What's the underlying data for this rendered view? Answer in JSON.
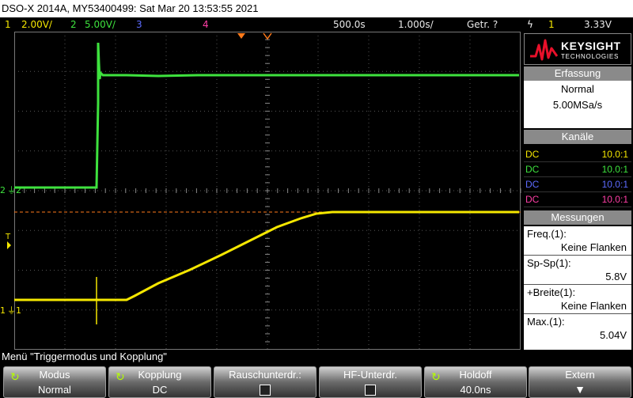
{
  "title_bar": "DSO-X 2014A, MY53400499: Sat Mar 20 13:53:55 2021",
  "status": {
    "ch1_num": "1",
    "ch1_scale": "2.00V/",
    "ch2_num": "2",
    "ch2_scale": "5.00V/",
    "ch3_num": "3",
    "ch4_num": "4",
    "timebase": "500.0s",
    "delay": "1.000s/",
    "mode": "Getr. ?",
    "trig_icon": "ϟ",
    "trig_source": "1",
    "trig_level": "3.33V"
  },
  "markers": {
    "ch2": "2",
    "ch1": "1",
    "trig": "T"
  },
  "logo": {
    "brand": "KEYSIGHT",
    "sub": "TECHNOLOGIES"
  },
  "acquisition": {
    "header": "Erfassung",
    "mode": "Normal",
    "rate": "5.00MSa/s"
  },
  "channels": {
    "header": "Kanäle",
    "rows": [
      {
        "coupling": "DC",
        "probe": "10.0:1",
        "color": "#f5e700"
      },
      {
        "coupling": "DC",
        "probe": "10.0:1",
        "color": "#3ee23e"
      },
      {
        "coupling": "DC",
        "probe": "10.0:1",
        "color": "#5d6bff"
      },
      {
        "coupling": "DC",
        "probe": "10.0:1",
        "color": "#ff3fa6"
      }
    ]
  },
  "measurements": {
    "header": "Messungen",
    "rows": [
      {
        "label": "Freq.(1):",
        "value": "Keine Flanken"
      },
      {
        "label": "Sp-Sp(1):",
        "value": "5.8V"
      },
      {
        "label": "+Breite(1):",
        "value": "Keine Flanken"
      },
      {
        "label": "Max.(1):",
        "value": "5.04V"
      }
    ]
  },
  "menu_title": "Menü \"Triggermodus und Kopplung\"",
  "softkeys": [
    {
      "top": "Modus",
      "bottom": "Normal"
    },
    {
      "top": "Kopplung",
      "bottom": "DC"
    },
    {
      "top": "Rauschunterdr.:",
      "bottom": ""
    },
    {
      "top": "HF-Unterdr.",
      "bottom": ""
    },
    {
      "top": "Holdoff",
      "bottom": "40.0ns"
    },
    {
      "top": "Extern",
      "bottom": ""
    }
  ],
  "colors": {
    "ch1": "#f5e700",
    "ch2": "#3ee23e",
    "ch3": "#5d6bff",
    "ch4": "#ff3fa6",
    "trigger_line": "#ff7a1a"
  }
}
